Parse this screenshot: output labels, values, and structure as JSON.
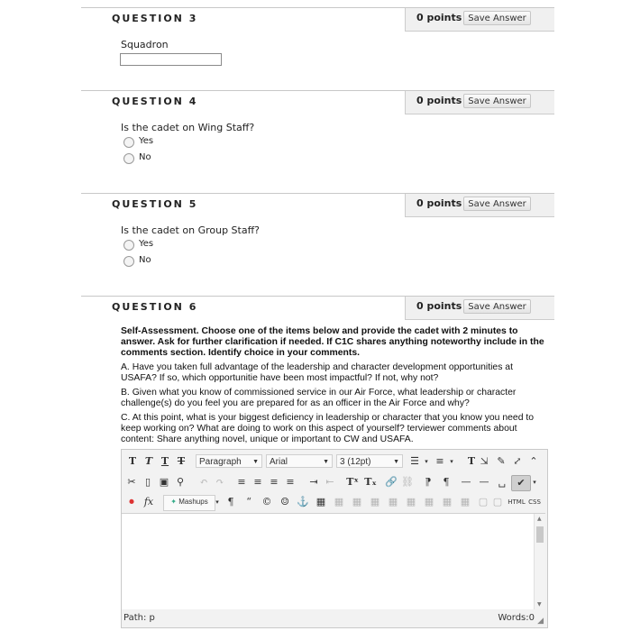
{
  "questions": [
    {
      "title": "QUESTION 3",
      "points": "0 points",
      "save_label": "Save Answer",
      "prompt": "Squadron",
      "input_value": ""
    },
    {
      "title": "QUESTION 4",
      "points": "0 points",
      "save_label": "Save Answer",
      "prompt": "Is the cadet on Wing Staff?",
      "options": [
        "Yes",
        "No"
      ]
    },
    {
      "title": "QUESTION 5",
      "points": "0 points",
      "save_label": "Save Answer",
      "prompt": "Is the cadet on Group Staff?",
      "options": [
        "Yes",
        "No"
      ]
    },
    {
      "title": "QUESTION 6",
      "points": "0 points",
      "save_label": "Save Answer",
      "instructions_bold": "Self-Assessment. Choose one of the items below and provide the cadet with 2 minutes to answer. Ask for further clarification if needed. If C1C shares anything noteworthy include in the comments section. Identify choice in your comments.",
      "item_a": "A. Have you taken full advantage of the leadership and character development opportunities at USAFA? If so, which opportunitie have been most impactful? If not, why not?",
      "item_b": "B. Given what you know of commissioned service in our Air Force, what leadership or character challenge(s) do you feel you are prepared for as an officer in the Air Force and why?",
      "item_c": "C.  At this point, what is your biggest deficiency in leadership or character that you know you need to keep working on? What are doing to work on this aspect of yourself? terviewer comments about content: Share anything novel, unique or important to CW and USAFA."
    }
  ],
  "editor": {
    "format_select": "Paragraph",
    "font_select": "Arial",
    "size_select": "3 (12pt)",
    "mashups_label": "Mashups",
    "html_label": "HTML",
    "css_label": "CSS",
    "path_label": "Path: p",
    "words_label": "Words:0"
  }
}
